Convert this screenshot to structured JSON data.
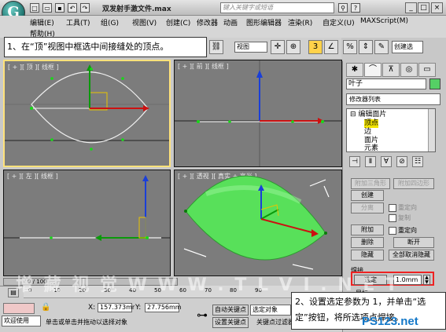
{
  "window": {
    "title": "双发射手激文件.max",
    "search_placeholder": "键入关键字或短语",
    "logo_letter": "G",
    "controls": [
      "_",
      "□",
      "×"
    ]
  },
  "menu": {
    "row1": [
      "编辑(E)",
      "工具(T)",
      "组(G)",
      "视图(V)",
      "创建(C)",
      "修改器",
      "动画",
      "图形编辑器",
      "渲染(R)",
      "自定义(U)",
      "MAXScript(M)"
    ],
    "row2": [
      "帮助(H)"
    ]
  },
  "instruction_1": "1、在“顶”视图中框选中间接缝处的顶点。",
  "instruction_2": "2、设置选定参数为 1，并单击“选定”按钮，将所选项点焊接。",
  "toolbar": {
    "view_dropdown": "视图",
    "snap_label": "3",
    "create_selection": "创建选"
  },
  "viewports": [
    {
      "label": "[ + ][ 顶 ][ 线框 ]",
      "active": true
    },
    {
      "label": "[ + ][ 前 ][ 线框 ]",
      "active": false
    },
    {
      "label": "[ + ][ 左 ][ 线框 ]",
      "active": false
    },
    {
      "label": "[ + ][ 透视 ][ 真实 + 高光 ]",
      "active": false
    }
  ],
  "command_panel": {
    "object_name": "叶子",
    "object_color": "#55d065",
    "modifier_list": "修改器列表",
    "stack": [
      {
        "text": "⊟ 编辑面片",
        "selected": false
      },
      {
        "text": "顶点",
        "selected": true
      },
      {
        "text": "边",
        "selected": false
      },
      {
        "text": "面片",
        "selected": false
      },
      {
        "text": "元素",
        "selected": false
      }
    ],
    "buttons_disabled": [
      "附加三角形",
      "附加四边形"
    ],
    "button_create": "创建",
    "button_split": "分离",
    "check_reorient": "重定向",
    "check_copy": "复制",
    "button_attach": "附加",
    "check_reorient2": "重定向",
    "button_delete": "删除",
    "button_break": "断开",
    "button_hide": "隐藏",
    "button_unhide_all": "全部取消隐藏",
    "weld_group": "焊接",
    "weld_button": "选定",
    "weld_value": "1.0mm",
    "target_label": "目标"
  },
  "timeline": {
    "frame": "0 / 100",
    "ticks": [
      "0",
      "10",
      "20",
      "30",
      "40",
      "50",
      "60",
      "70",
      "80",
      "90"
    ]
  },
  "status": {
    "x_label": "X:",
    "x_value": "157.373mr",
    "y_label": "Y:",
    "y_value": "27.756mm",
    "welcome": "欢迎使用",
    "prompt": "单击或单击并拖动以选择对象",
    "auto_key": "自动关键点",
    "selected_object": "选定对象",
    "set_key": "设置关键点",
    "key_filter": "关键点过滤器..."
  },
  "watermark": "PS123.net",
  "watermark_cn": "增 藏 视 觉   W W W . T L V I . N E T"
}
